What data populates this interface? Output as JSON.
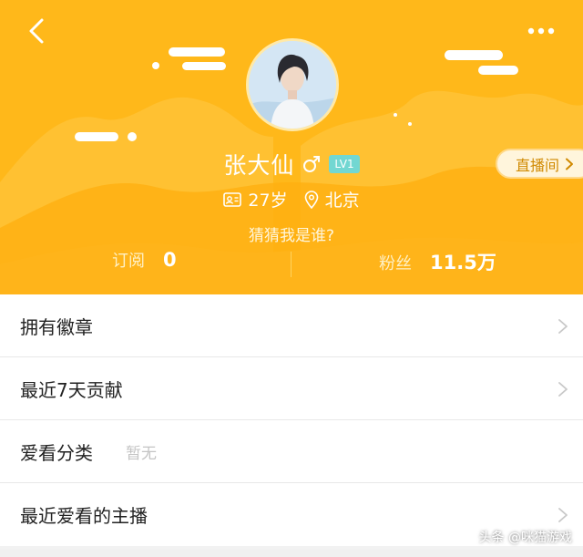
{
  "colors": {
    "header_bg": "#ffb81a",
    "accent_orange": "#d08900",
    "level_badge": "#72d7d2"
  },
  "nav": {
    "back_icon": "chevron-left-icon",
    "more_icon": "more-dots-icon"
  },
  "profile": {
    "name": "张大仙",
    "gender_icon": "male-icon",
    "level": "LV1",
    "age": "27岁",
    "age_icon": "id-card-icon",
    "location": "北京",
    "location_icon": "location-pin-icon",
    "bio": "猜猜我是谁?"
  },
  "live_button": {
    "label": "直播间",
    "icon": "chevron-right-icon"
  },
  "stats": {
    "subscribe_label": "订阅",
    "subscribe_value": "0",
    "fans_label": "粉丝",
    "fans_value": "11.5万"
  },
  "menu": {
    "items": [
      {
        "label": "拥有徽章",
        "value": ""
      },
      {
        "label": "最近7天贡献",
        "value": ""
      },
      {
        "label": "爱看分类",
        "value": "暂无"
      },
      {
        "label": "最近爱看的主播",
        "value": ""
      }
    ]
  },
  "watermark": "头条 @咪猫游戏"
}
